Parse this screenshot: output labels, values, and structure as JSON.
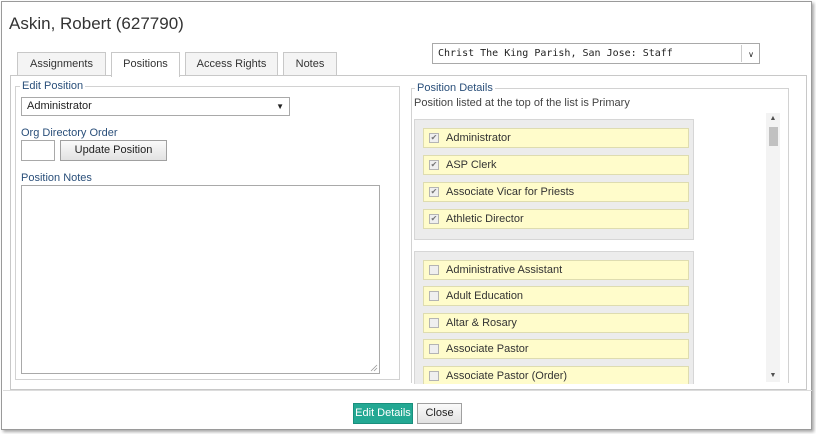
{
  "dialog": {
    "title": "Askin, Robert (627790)"
  },
  "tabs": [
    {
      "label": "Assignments",
      "active": false
    },
    {
      "label": "Positions",
      "active": true
    },
    {
      "label": "Access Rights",
      "active": false
    },
    {
      "label": "Notes",
      "active": false
    }
  ],
  "org_select": {
    "value": "Christ The King Parish, San Jose: Staff"
  },
  "edit_position": {
    "legend": "Edit Position",
    "selected": "Administrator",
    "org_directory_label": "Org Directory Order",
    "org_directory_value": "",
    "update_button": "Update Position",
    "notes_label": "Position Notes",
    "notes_value": ""
  },
  "position_details": {
    "legend": "Position Details",
    "hint": "Position listed at the top of the list is Primary",
    "assigned": [
      {
        "label": "Administrator",
        "checked": true
      },
      {
        "label": "ASP Clerk",
        "checked": true
      },
      {
        "label": "Associate Vicar for Priests",
        "checked": true
      },
      {
        "label": "Athletic Director",
        "checked": true
      }
    ],
    "available": [
      {
        "label": "Administrative Assistant",
        "checked": false
      },
      {
        "label": "Adult Education",
        "checked": false
      },
      {
        "label": "Altar & Rosary",
        "checked": false
      },
      {
        "label": "Associate Pastor",
        "checked": false
      },
      {
        "label": "Associate Pastor (Order)",
        "checked": false
      }
    ]
  },
  "footer": {
    "edit_button": "Edit Details",
    "close_button": "Close"
  },
  "colors": {
    "accent": "#23a893",
    "item_bg": "#fffccb",
    "group_bg": "#ececec"
  },
  "icons": {
    "dropdown": "chevron-down-icon",
    "checkbox": "check-icon"
  }
}
